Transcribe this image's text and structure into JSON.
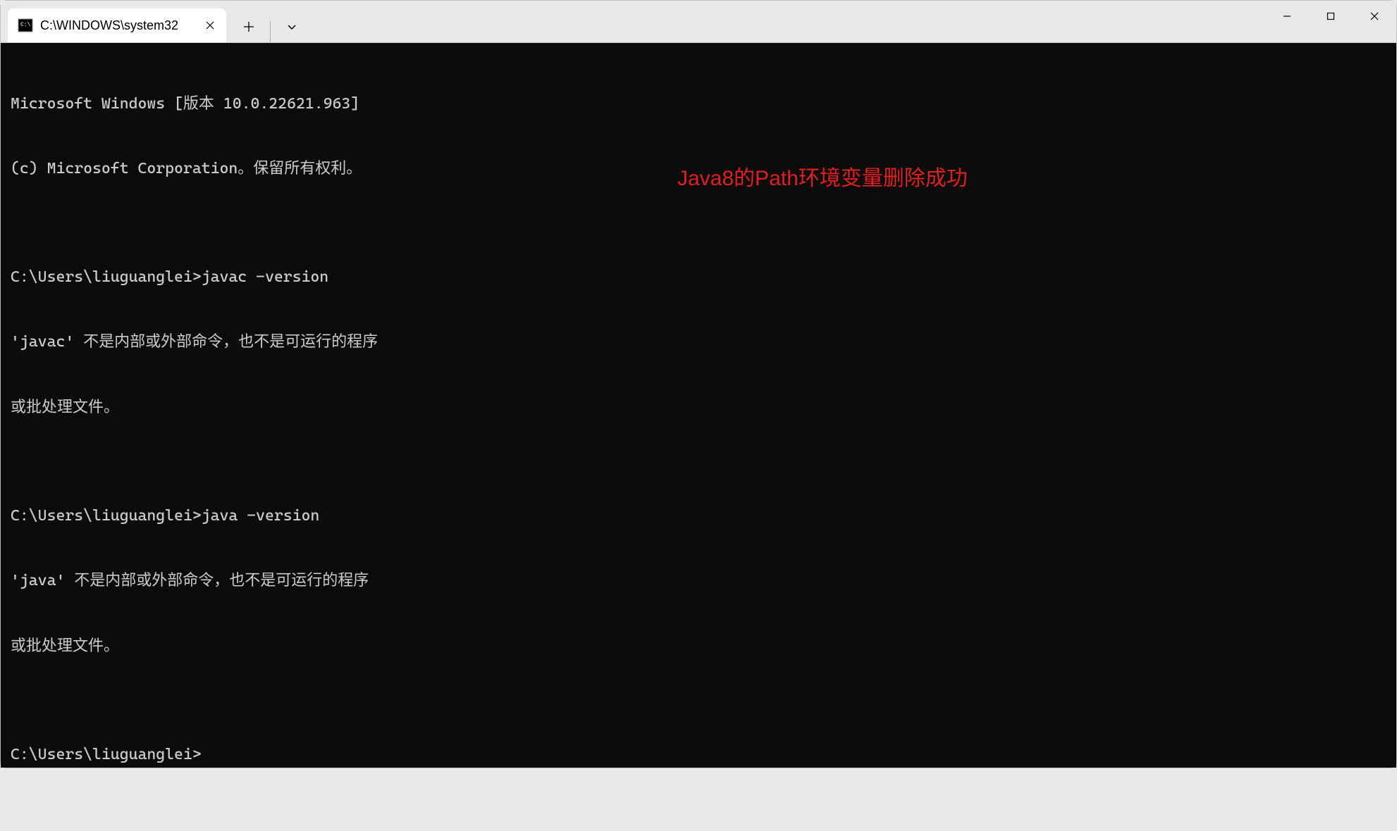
{
  "titlebar": {
    "tab": {
      "title": "C:\\WINDOWS\\system32"
    }
  },
  "terminal": {
    "lines": [
      "Microsoft Windows [版本 10.0.22621.963]",
      "(c) Microsoft Corporation。保留所有权利。",
      "",
      "C:\\Users\\liuguanglei>javac -version",
      "'javac' 不是内部或外部命令，也不是可运行的程序",
      "或批处理文件。",
      "",
      "C:\\Users\\liuguanglei>java -version",
      "'java' 不是内部或外部命令，也不是可运行的程序",
      "或批处理文件。",
      "",
      "C:\\Users\\liuguanglei>"
    ]
  },
  "annotation": {
    "text": "Java8的Path环境变量删除成功"
  }
}
